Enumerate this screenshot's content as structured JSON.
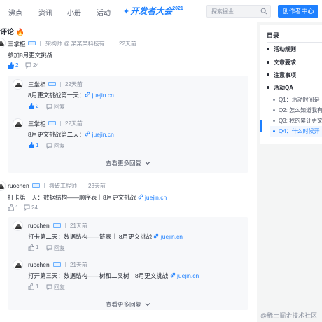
{
  "nav": {
    "items": [
      "沸点",
      "资讯",
      "小册",
      "活动"
    ],
    "brand": "开发者大会",
    "brand_year": "2021",
    "search_placeholder": "探索掘金",
    "creator_button": "创作者中心"
  },
  "section_title": "评论",
  "threads": [
    {
      "author": "三掌柜",
      "title": "架构师 @ 某某某科技有...",
      "time": "22天前",
      "text": "参加8月更文挑战",
      "likes": "2",
      "comments": "24",
      "liked": true,
      "replies": [
        {
          "author": "三掌柜",
          "time": "22天前",
          "text": "8月更文挑战第一天：",
          "link": "juejin.cn",
          "likes": "2",
          "reply_label": "回复",
          "liked": true
        },
        {
          "author": "三掌柜",
          "time": "22天前",
          "text": "8月更文挑战第二天：",
          "link": "juejin.cn",
          "likes": "1",
          "reply_label": "回复",
          "liked": true
        }
      ],
      "more_label": "查看更多回复"
    },
    {
      "author": "ruochen",
      "title": "搬砖工程师",
      "time": "23天前",
      "text": "打卡第一天：数据结构——顺序表｜8月更文挑战",
      "link": "juejin.cn",
      "likes": "1",
      "comments": "24",
      "liked": false,
      "replies": [
        {
          "author": "ruochen",
          "time": "21天前",
          "text": "打卡第二天：数据结构——链表｜ 8月更文挑战",
          "link": "juejin.cn",
          "likes": "1",
          "reply_label": "回复",
          "liked": false
        },
        {
          "author": "ruochen",
          "time": "21天前",
          "text": "打开第三天：数据结构——树和二叉树｜8月更文挑战",
          "link": "juejin.cn",
          "likes": "1",
          "reply_label": "回复",
          "liked": false
        }
      ],
      "more_label": "查看更多回复"
    }
  ],
  "toc": {
    "title": "目录",
    "items": [
      "活动规则",
      "文章要求",
      "注意事项",
      "活动QA"
    ],
    "sub_items": [
      "Q1：活动时间是",
      "Q2: 怎么知道我有",
      "Q3: 我的累计更文",
      "Q4：什么时候开"
    ]
  },
  "watermark": "@稀土掘金技术社区",
  "colors": {
    "accent": "#1e80ff",
    "fire": "#f53f3f"
  }
}
